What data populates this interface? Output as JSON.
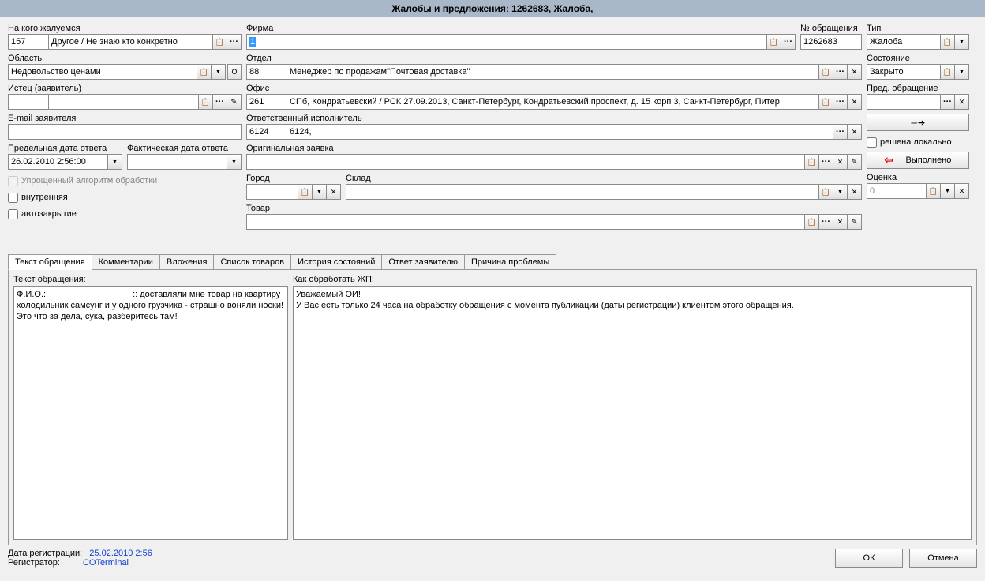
{
  "title": "Жалобы и предложения: 1262683, Жалоба, ",
  "left": {
    "complainee_label": "На кого жалуемся",
    "complainee_code": "157",
    "complainee_text": "Другое / Не знаю кто конкретно",
    "region_label": "Область",
    "region_value": "Недовольство ценами",
    "claimant_label": "Истец (заявитель)",
    "claimant_code": "",
    "claimant_name": "",
    "email_label": "E-mail заявителя",
    "email_value": "",
    "deadline_label": "Предельная дата ответа",
    "deadline_value": "26.02.2010 2:56:00",
    "actual_label": "Фактическая дата ответа",
    "actual_value": "",
    "simplified": "Упрощенный алгоритм обработки",
    "internal": "внутренняя",
    "autoclose": "автозакрытие"
  },
  "mid": {
    "firm_label": "Фирма",
    "firm_code": "1",
    "firm_text": "",
    "dept_label": "Отдел",
    "dept_code": "88",
    "dept_text": "Менеджер по продажам\"Почтовая доставка\"",
    "office_label": "Офис",
    "office_code": "261",
    "office_text": "СПб, Кондратьевский / РСК 27.09.2013, Санкт-Петербург, Кондратьевский проспект, д. 15 корп 3, Санкт-Петербург, Питер",
    "resp_label": "Ответственный исполнитель",
    "resp_code": "6124",
    "resp_text": "6124, ",
    "orig_label": "Оригинальная заявка",
    "city_label": "Город",
    "warehouse_label": "Склад",
    "product_label": "Товар"
  },
  "right": {
    "num_label": "№ обращения",
    "num_value": "1262683",
    "type_label": "Тип",
    "type_value": "Жалоба",
    "state_label": "Состояние",
    "state_value": "Закрыто",
    "prev_label": "Пред. обращение",
    "local": "решена локально",
    "done": "Выполнено",
    "rating_label": "Оценка",
    "rating_value": "0"
  },
  "tabs": [
    "Текст обращения",
    "Комментарии",
    "Вложения",
    "Список товаров",
    "История состояний",
    "Ответ заявителю",
    "Причина проблемы"
  ],
  "text_panel": {
    "left_label": "Текст обращения:",
    "left_body": "Ф.И.О.:                                    :: доставляли мне товар на квартиру холодильник самсунг и у одного грузчика - страшно воняли носки! Это что за дела, сука, разберитесь там!",
    "right_label": "Как обработать ЖП:",
    "right_body": "Уважаемый ОИ!\nУ Вас есть только 24 часа на обработку обращения с момента публикации (даты регистрации) клиентом этого обращения."
  },
  "footer": {
    "reg_date_label": "Дата регистрации:",
    "reg_date": "25.02.2010 2:56",
    "registrar_label": "Регистратор:",
    "registrar": "COTerminal",
    "ok": "ОК",
    "cancel": "Отмена"
  }
}
